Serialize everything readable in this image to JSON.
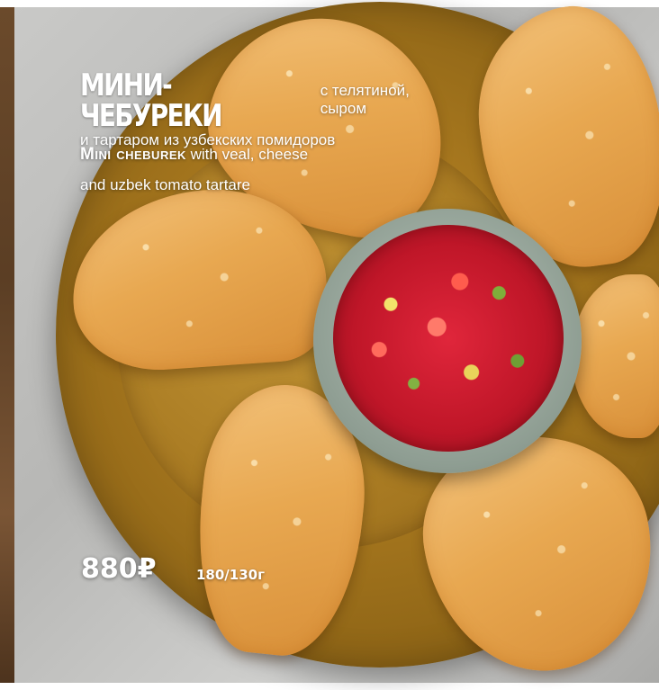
{
  "dish": {
    "title_ru": "МИНИ-ЧЕБУРЕКИ",
    "desc_ru_line1": "с телятиной, сыром",
    "desc_ru_line2": "и тартаром из узбекских помидоров",
    "title_en": "Mini cheburek",
    "desc_en_line1": "with veal, cheese",
    "desc_en_line2": "and uzbek tomato tartare"
  },
  "pricing": {
    "price": "880₽",
    "weight": "180/130г"
  },
  "colors": {
    "text": "#ffffff",
    "plate": "#a9791f",
    "bowl": "#8e9d92",
    "salsa": "#c11729"
  }
}
